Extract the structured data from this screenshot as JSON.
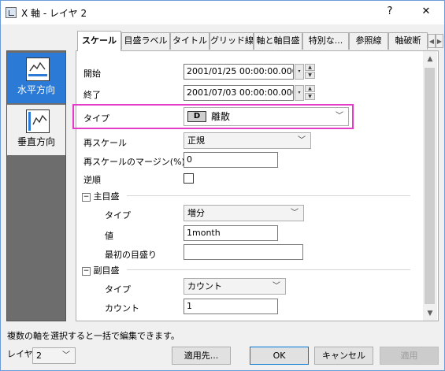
{
  "window": {
    "title": "X 軸 - レイヤ 2",
    "help": "?",
    "close": "✕"
  },
  "sidebar": {
    "items": [
      {
        "label": "水平方向"
      },
      {
        "label": "垂直方向"
      }
    ]
  },
  "tabs": [
    "スケール",
    "目盛ラベル",
    "タイトル",
    "グリッド線",
    "軸と軸目盛",
    "特別な...",
    "参照線",
    "軸破断"
  ],
  "form": {
    "start": {
      "label": "開始",
      "value": "2001/01/25 00:00:00.000"
    },
    "end": {
      "label": "終了",
      "value": "2001/07/03 00:00:00.000"
    },
    "type": {
      "label": "タイプ",
      "value": "離散",
      "icon_text": "D"
    },
    "rescale": {
      "label": "再スケール",
      "value": "正規"
    },
    "rescale_margin": {
      "label": "再スケールのマージン(%)",
      "value": "0"
    },
    "reverse": {
      "label": "逆順",
      "checked": false
    },
    "major": {
      "title": "主目盛",
      "type_label": "タイプ",
      "type_value": "増分",
      "value_label": "値",
      "value_value": "1month",
      "first_label": "最初の目盛り",
      "first_value": ""
    },
    "minor": {
      "title": "副目盛",
      "type_label": "タイプ",
      "type_value": "カウント",
      "count_label": "カウント",
      "count_value": "1"
    }
  },
  "status_text": "複数の軸を選択すると一括で編集できます。",
  "bottom": {
    "layer_label": "レイヤ",
    "layer_value": "2",
    "apply_to": "適用先...",
    "ok": "OK",
    "cancel": "キャンセル",
    "apply": "適用"
  },
  "colors": {
    "highlight": "#e43cc8",
    "sidebar_active": "#2a7ad6",
    "sidebar_bg": "#6d6d6d"
  }
}
